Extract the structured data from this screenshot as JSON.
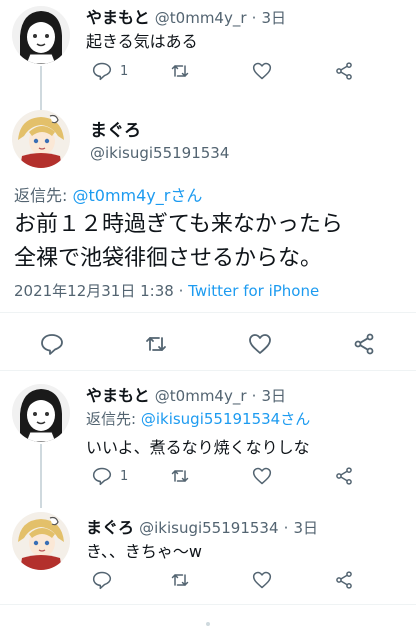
{
  "tweet1": {
    "name": "やまもと",
    "handle": "@t0mm4y_r",
    "time": "3日",
    "text": "起きる気はある",
    "reply_count": "1"
  },
  "main_tweet": {
    "name": "まぐろ",
    "handle": "@ikisugi55191534",
    "reply_label": "返信先:",
    "reply_target": "@t0mm4y_rさん",
    "text_line1": "お前１２時過ぎても来なかったら",
    "text_line2": "全裸で池袋徘徊させるからな。",
    "date": "2021年12月31日 1:38",
    "separator": "·",
    "source": "Twitter for iPhone"
  },
  "tweet3": {
    "name": "やまもと",
    "handle": "@t0mm4y_r",
    "time": "3日",
    "reply_label": "返信先:",
    "reply_target": "@ikisugi55191534さん",
    "text": "いいよ、煮るなり焼くなりしな",
    "reply_count": "1"
  },
  "tweet4": {
    "name": "まぐろ",
    "handle": "@ikisugi55191534",
    "time": "3日",
    "text": "き、、きちゃ〜w"
  },
  "colors": {
    "link": "#1d9bf0",
    "secondary_text": "#536471",
    "divider": "#eff3f4"
  },
  "icons": [
    "reply-icon",
    "retweet-icon",
    "like-icon",
    "share-icon"
  ]
}
